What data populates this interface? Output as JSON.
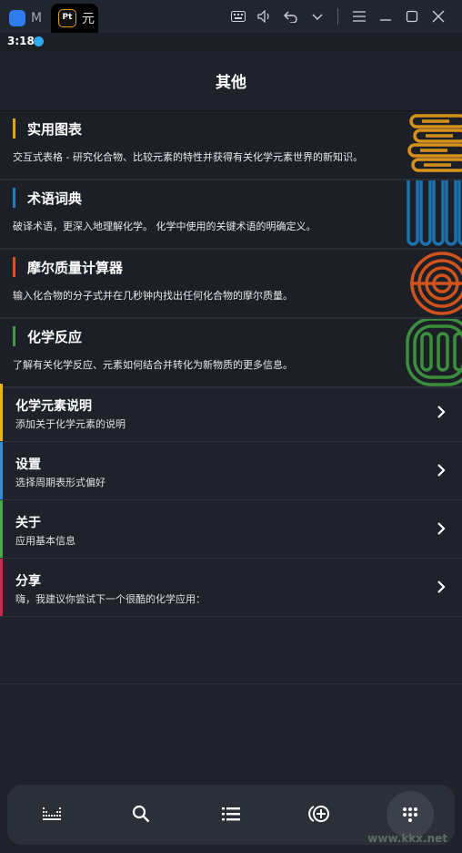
{
  "window": {
    "tab1_label": "M",
    "tab2_label": "元",
    "tab2_badge": "Pt"
  },
  "status": {
    "time": "3:18"
  },
  "header": {
    "title": "其他"
  },
  "cards": [
    {
      "title": "实用图表",
      "desc": "交互式表格 - 研究化合物、比较元素的特性并获得有关化学元素世界的新知识。",
      "accent": "#e0a11b"
    },
    {
      "title": "术语词典",
      "desc": "破译术语，更深入地理解化学。 化学中使用的关键术语的明确定义。",
      "accent": "#1d7fc0"
    },
    {
      "title": "摩尔质量计算器",
      "desc": "输入化合物的分子式并在几秒钟内找出任何化合物的摩尔质量。",
      "accent": "#d4541c"
    },
    {
      "title": "化学反应",
      "desc": "了解有关化学反应、元素如何结合并转化为新物质的更多信息。",
      "accent": "#3f9a40"
    }
  ],
  "rows": [
    {
      "title": "化学元素说明",
      "sub": "添加关于化学元素的说明",
      "accent": "#e8b21b"
    },
    {
      "title": "设置",
      "sub": "选择周期表形式偏好",
      "accent": "#2f8fdc"
    },
    {
      "title": "关于",
      "sub": "应用基本信息",
      "accent": "#49a84a"
    },
    {
      "title": "分享",
      "sub": "嗨，我建议你尝试下一个很酷的化学应用：",
      "accent": "#c42c4c"
    }
  ],
  "nav_icons": [
    "table-icon",
    "search-icon",
    "list-icon",
    "molar-icon",
    "more-icon"
  ],
  "watermark": "www.kkx.net"
}
